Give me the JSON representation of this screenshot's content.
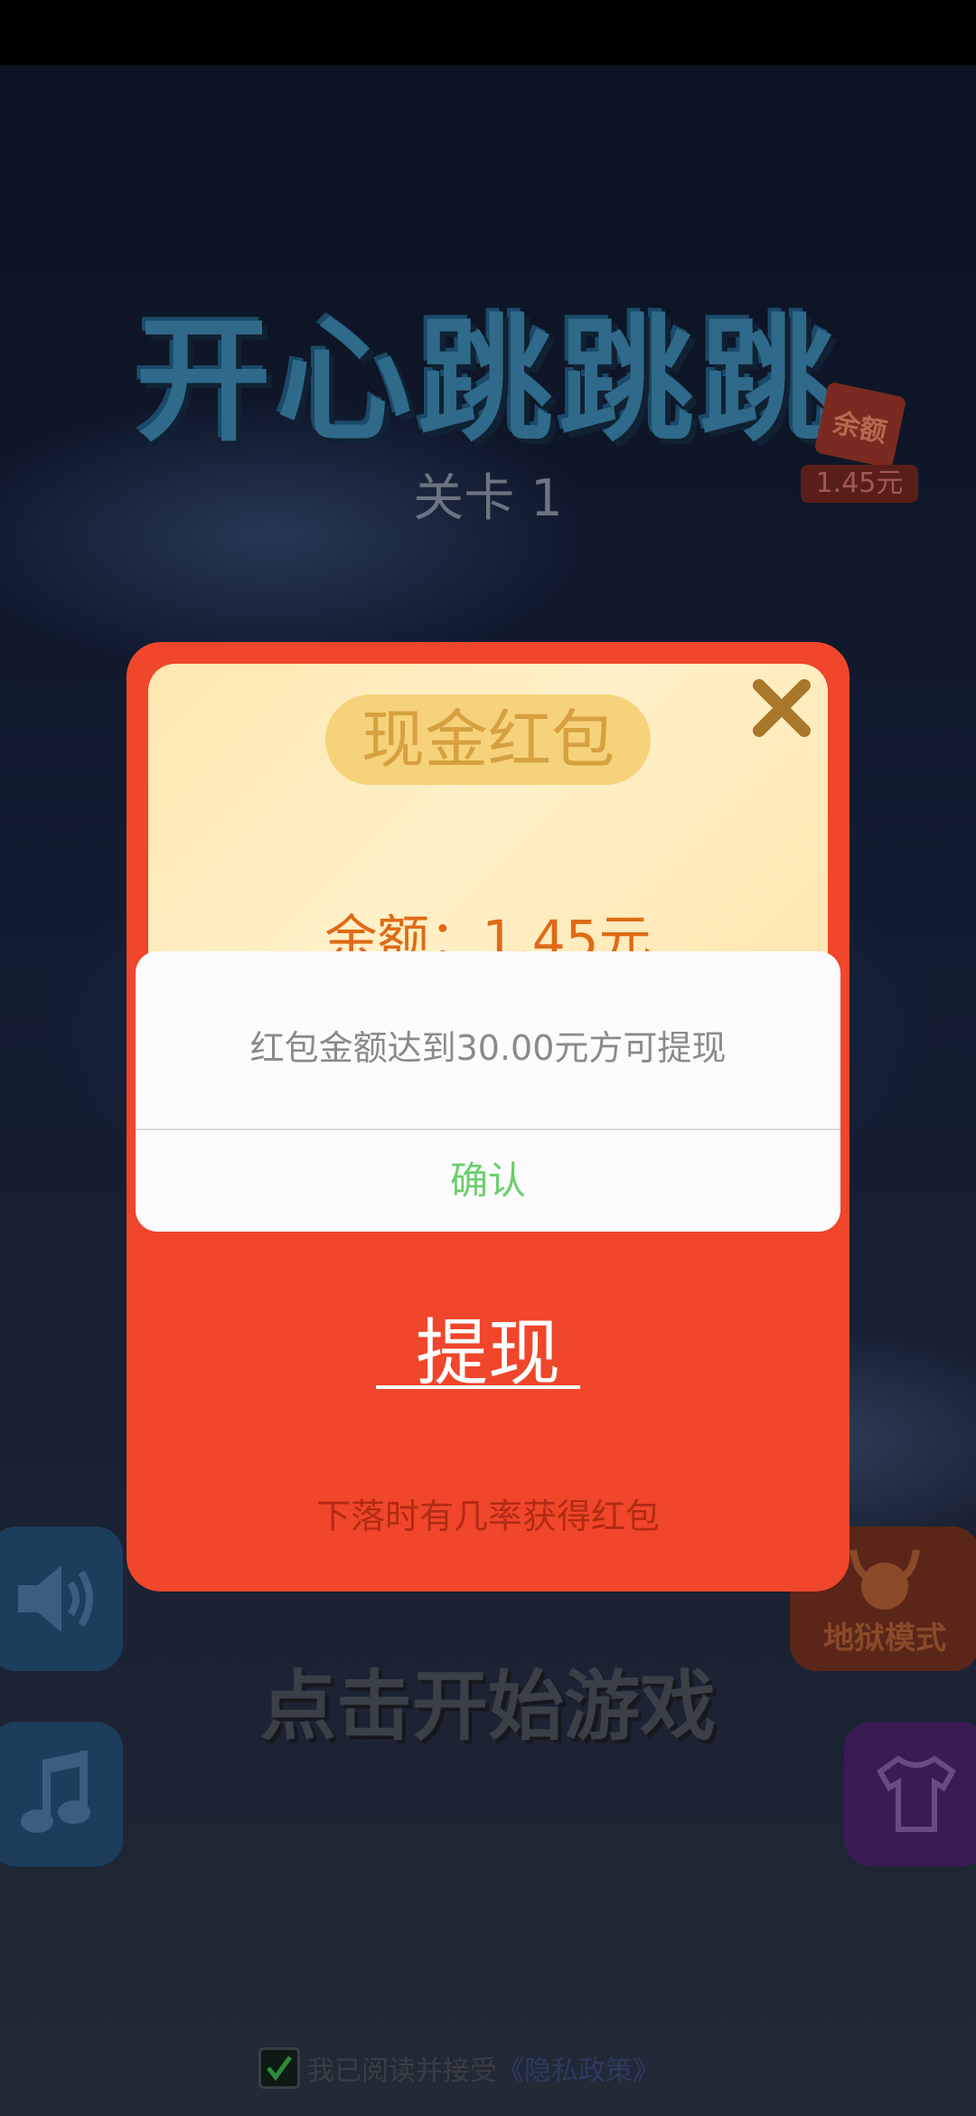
{
  "game": {
    "title": "开心跳跳跳",
    "level": "关卡 1",
    "balance_badge": {
      "tag": "余额",
      "amount": "1.45元"
    },
    "start_prompt": "点击开始游戏",
    "hell_mode_label": "地狱模式",
    "privacy": {
      "text": "我已阅读并接受",
      "link": "《隐私政策》",
      "checked": true
    }
  },
  "red_packet": {
    "title": "现金红包",
    "balance": "余额：1.45元",
    "withdraw_label": "提现",
    "hint": "下落时有几率获得红包"
  },
  "alert": {
    "message": "红包金额达到30.00元方可提现",
    "confirm_label": "确认"
  },
  "colors": {
    "packet_red": "#f0462b",
    "confirm_green": "#6cce6c",
    "balance_orange": "#e06a16"
  }
}
